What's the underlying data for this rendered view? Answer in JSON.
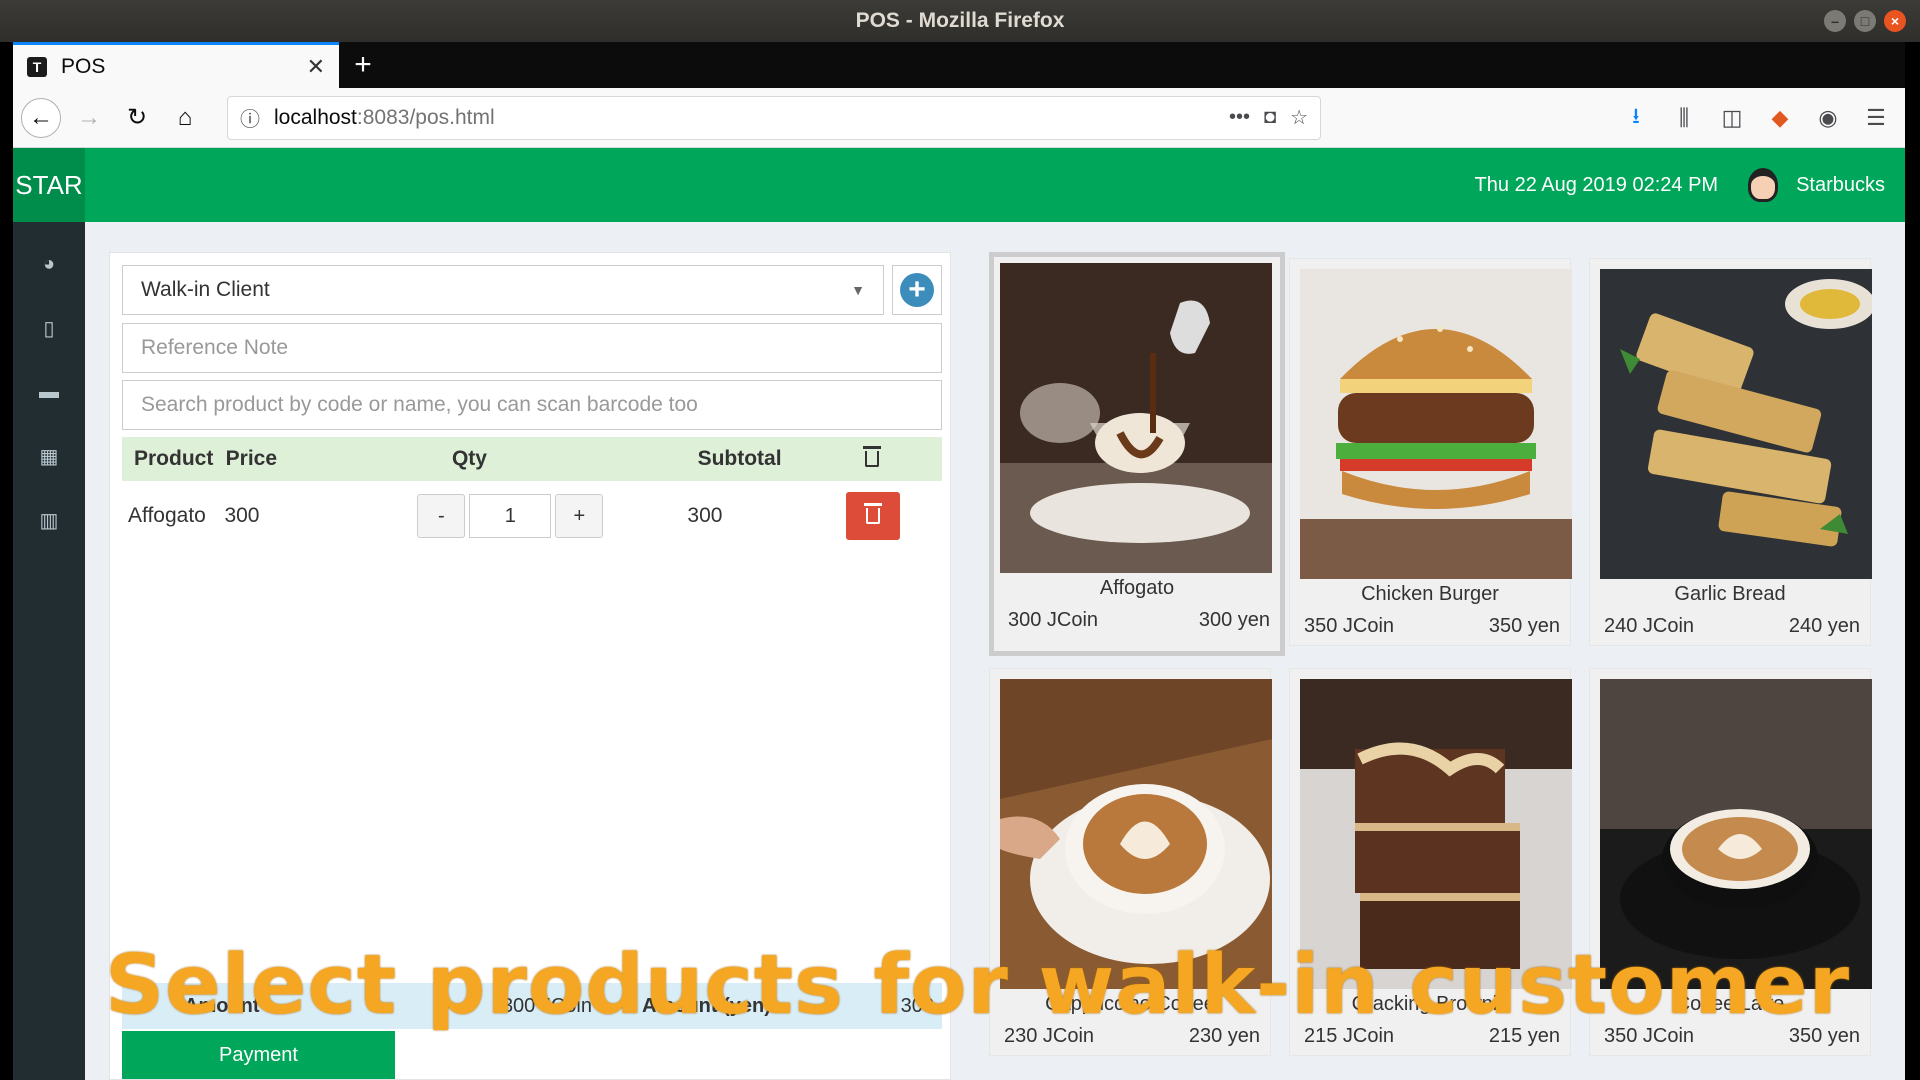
{
  "window": {
    "title": "POS - Mozilla Firefox"
  },
  "browser": {
    "tab_title": "POS",
    "tab_favicon": "T",
    "url_host": "localhost",
    "url_path": ":8083/pos.html"
  },
  "header": {
    "logo": "STAR",
    "datetime": "Thu 22 Aug 2019 02:24 PM",
    "user_name": "Starbucks"
  },
  "sidebar": {
    "items": [
      {
        "icon": "dashboard-icon"
      },
      {
        "icon": "receipt-icon"
      },
      {
        "icon": "folder-icon"
      },
      {
        "icon": "grid-icon"
      },
      {
        "icon": "bar-chart-icon"
      }
    ]
  },
  "cart": {
    "client_select": "Walk-in Client",
    "reference_placeholder": "Reference Note",
    "search_placeholder": "Search product by code or name, you can scan barcode too",
    "columns": {
      "product": "Product",
      "price": "Price",
      "qty": "Qty",
      "subtotal": "Subtotal"
    },
    "items": [
      {
        "product": "Affogato",
        "price": "300",
        "qty": "1",
        "subtotal": "300"
      }
    ],
    "totals": {
      "amount_label": "Amount",
      "amount_value": "300 JCoin",
      "amount_yen_label": "Amount (yen)",
      "amount_yen_value": "300"
    },
    "payment_label": "Payment"
  },
  "products": [
    {
      "name": "Affogato",
      "coin": "300 JCoin",
      "yen": "300 yen"
    },
    {
      "name": "Chicken Burger",
      "coin": "350 JCoin",
      "yen": "350 yen"
    },
    {
      "name": "Garlic Bread",
      "coin": "240 JCoin",
      "yen": "240 yen"
    },
    {
      "name": "Cappuccino Coffee",
      "coin": "230 JCoin",
      "yen": "230 yen"
    },
    {
      "name": "Cracking Brownie",
      "coin": "215 JCoin",
      "yen": "215 yen"
    },
    {
      "name": "Coffee Latte",
      "coin": "350 JCoin",
      "yen": "350 yen"
    }
  ],
  "overlay_caption": "Select products for walk-in customer",
  "colors": {
    "header": "#00a65a",
    "sidebar": "#222d32",
    "danger": "#dd4b39",
    "primary": "#3c8dbc",
    "caption": "#f5a623"
  }
}
